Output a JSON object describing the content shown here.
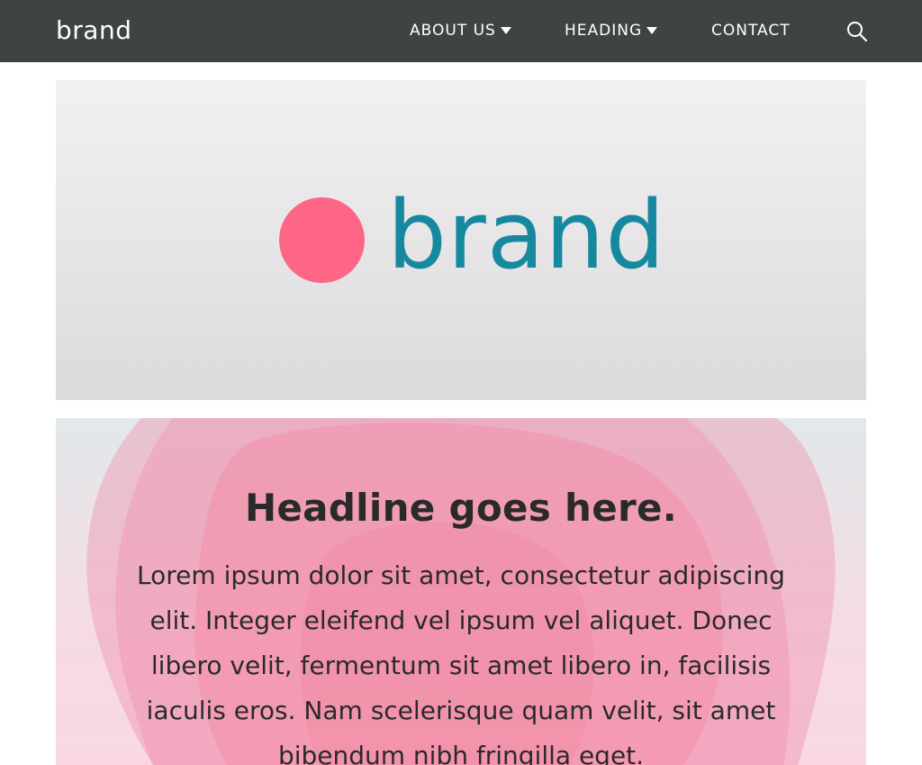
{
  "nav": {
    "brand": "brand",
    "items": [
      {
        "label": "ABOUT US",
        "has_dropdown": true
      },
      {
        "label": "HEADING",
        "has_dropdown": true
      },
      {
        "label": "CONTACT",
        "has_dropdown": false
      }
    ],
    "search_icon": "search-icon"
  },
  "hero": {
    "brand": "brand",
    "dot_color": "#fe6686",
    "brand_color": "#17899e"
  },
  "content": {
    "headline": "Headline goes here.",
    "body": "Lorem ipsum dolor sit amet, consectetur adipiscing elit. Integer eleifend vel ipsum vel aliquet. Donec libero velit, fermentum sit amet libero in, facilisis iaculis eros. Nam scelerisque quam velit, sit amet bibendum nibh fringilla eget."
  },
  "colors": {
    "nav_bg": "#3e4343",
    "accent_pink": "#fe6686",
    "accent_teal": "#17899e"
  }
}
